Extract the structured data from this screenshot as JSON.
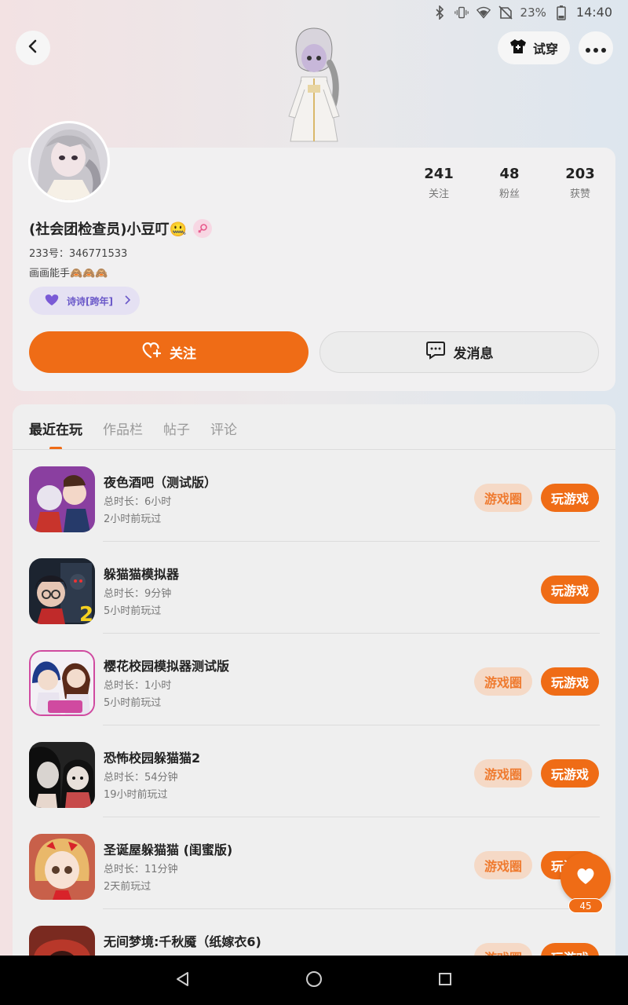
{
  "status_bar": {
    "battery": "23%",
    "time": "14:40",
    "icons": [
      "bluetooth-icon",
      "vibrate-icon",
      "wifi-icon",
      "no-sim-icon",
      "battery-icon"
    ]
  },
  "header": {
    "try_on_label": "试穿"
  },
  "profile": {
    "stats": [
      {
        "value": "241",
        "label": "关注"
      },
      {
        "value": "48",
        "label": "粉丝"
      },
      {
        "value": "203",
        "label": "获赞"
      }
    ],
    "username": "(社会团检查员)小豆叮🤐",
    "uid": "233号：346771533",
    "bio": "画画能手🙈🙈🙈",
    "title_badge": "诗诗[跨年]",
    "follow_label": "关注",
    "message_label": "发消息"
  },
  "tabs": [
    "最近在玩",
    "作品栏",
    "帖子",
    "评论"
  ],
  "games": [
    {
      "name": "夜色酒吧（测试版）",
      "duration": "总时长：6小时",
      "last_played": "2小时前玩过",
      "circle_label": "游戏圈",
      "play_label": "玩游戏",
      "has_circle": true,
      "icon_color": "#8a3fa0"
    },
    {
      "name": "躲猫猫模拟器",
      "duration": "总时长：9分钟",
      "last_played": "5小时前玩过",
      "circle_label": "",
      "play_label": "玩游戏",
      "has_circle": false,
      "icon_color": "#1c2430"
    },
    {
      "name": "樱花校园模拟器测试版",
      "duration": "总时长：1小时",
      "last_played": "5小时前玩过",
      "circle_label": "游戏圈",
      "play_label": "玩游戏",
      "has_circle": true,
      "icon_color": "#d04aa0"
    },
    {
      "name": "恐怖校园躲猫猫2",
      "duration": "总时长：54分钟",
      "last_played": "19小时前玩过",
      "circle_label": "游戏圈",
      "play_label": "玩游戏",
      "has_circle": true,
      "icon_color": "#222222"
    },
    {
      "name": "圣诞屋躲猫猫 (闺蜜版)",
      "duration": "总时长：11分钟",
      "last_played": "2天前玩过",
      "circle_label": "游戏圈",
      "play_label": "玩游戏",
      "has_circle": true,
      "icon_color": "#c8604a"
    },
    {
      "name": "无间梦境:千秋魇（纸嫁衣6)",
      "duration": "",
      "last_played": "",
      "circle_label": "游戏圈",
      "play_label": "玩游戏",
      "has_circle": true,
      "icon_color": "#7a2a20"
    }
  ],
  "like_count": "45",
  "colors": {
    "accent": "#ef6c16",
    "accent_light": "#f5d9c6",
    "title_badge": "#6a58c9"
  }
}
